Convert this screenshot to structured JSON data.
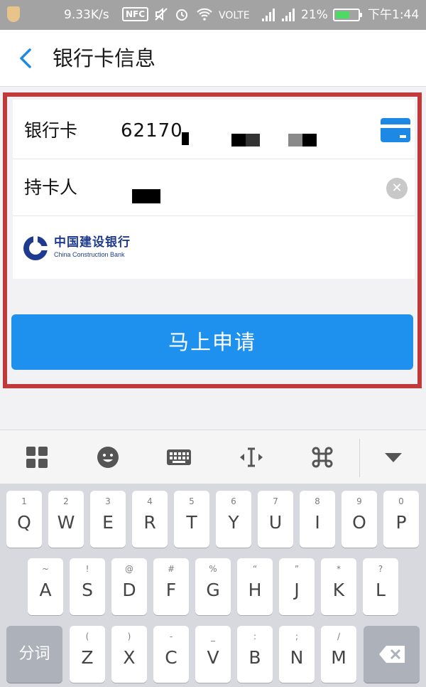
{
  "status_bar": {
    "speed": "9.33K/s",
    "nfc": "NFC",
    "volte": "VOLTE",
    "battery": "21%",
    "battery_level": 0.21,
    "time": "下午1:44"
  },
  "header": {
    "title": "银行卡信息",
    "back_icon": "chevron-left-icon"
  },
  "form": {
    "bank_card_label": "银行卡",
    "bank_card_value": "62170",
    "card_holder_label": "持卡人",
    "card_holder_value": "",
    "bank_name_cn": "中国建设银行",
    "bank_name_en": "China Construction Bank",
    "apply_button": "马上申请"
  },
  "keyboard": {
    "toolbar_icons": [
      "grid-icon",
      "emoji-icon",
      "keyboard-icon",
      "cursor-icon",
      "command-icon",
      "collapse-icon"
    ],
    "row1": [
      {
        "main": "Q",
        "sub": "1"
      },
      {
        "main": "W",
        "sub": "2"
      },
      {
        "main": "E",
        "sub": "3"
      },
      {
        "main": "R",
        "sub": "4"
      },
      {
        "main": "T",
        "sub": "5"
      },
      {
        "main": "Y",
        "sub": "6"
      },
      {
        "main": "U",
        "sub": "7"
      },
      {
        "main": "I",
        "sub": "8"
      },
      {
        "main": "O",
        "sub": "9"
      },
      {
        "main": "P",
        "sub": "0"
      }
    ],
    "row2": [
      {
        "main": "A",
        "sub": "~"
      },
      {
        "main": "S",
        "sub": "!"
      },
      {
        "main": "D",
        "sub": "@"
      },
      {
        "main": "F",
        "sub": "#"
      },
      {
        "main": "G",
        "sub": "%"
      },
      {
        "main": "H",
        "sub": "“"
      },
      {
        "main": "J",
        "sub": "”"
      },
      {
        "main": "K",
        "sub": "*"
      },
      {
        "main": "L",
        "sub": "?"
      }
    ],
    "row3": [
      {
        "main": "Z",
        "sub": "("
      },
      {
        "main": "X",
        "sub": ")"
      },
      {
        "main": "C",
        "sub": "-"
      },
      {
        "main": "V",
        "sub": "_"
      },
      {
        "main": "B",
        "sub": ":"
      },
      {
        "main": "N",
        "sub": ";"
      },
      {
        "main": "M",
        "sub": "/"
      }
    ],
    "segment_key": "分词",
    "delete_icon": "backspace-icon"
  },
  "colors": {
    "accent": "#1e90ee",
    "highlight_border": "#c0393b",
    "bank_brand": "#1f3b8f"
  }
}
